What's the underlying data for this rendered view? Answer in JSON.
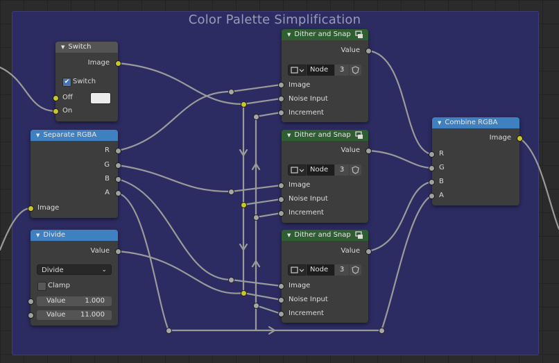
{
  "frame": {
    "title": "Color Palette Simplification"
  },
  "switch_node": {
    "title": "Switch",
    "output_image": "Image",
    "checkbox_label": "Switch",
    "checkbox_checked": true,
    "input_off": "Off",
    "input_on": "On",
    "swatch_color": "#ececec"
  },
  "separate_rgba": {
    "title": "Separate RGBA",
    "outputs": [
      "R",
      "G",
      "B",
      "A"
    ],
    "input_image": "Image"
  },
  "divide": {
    "title": "Divide",
    "output_value": "Value",
    "operation": "Divide",
    "clamp_label": "Clamp",
    "clamp_checked": false,
    "value1_label": "Value",
    "value1": "1.000",
    "value2_label": "Value",
    "value2": "11.000"
  },
  "dither_nodes": [
    {
      "title": "Dither and Snap",
      "output_value": "Value",
      "group_name": "Node",
      "group_users": "3",
      "inputs": [
        "Image",
        "Noise Input",
        "Increment"
      ]
    },
    {
      "title": "Dither and Snap",
      "output_value": "Value",
      "group_name": "Node",
      "group_users": "3",
      "inputs": [
        "Image",
        "Noise Input",
        "Increment"
      ]
    },
    {
      "title": "Dither and Snap",
      "output_value": "Value",
      "group_name": "Node",
      "group_users": "3",
      "inputs": [
        "Image",
        "Noise Input",
        "Increment"
      ]
    }
  ],
  "combine_rgba": {
    "title": "Combine RGBA",
    "output_image": "Image",
    "inputs": [
      "R",
      "G",
      "B",
      "A"
    ]
  },
  "colors": {
    "frame_bg": "#2d2c62",
    "node_bg": "#3d3d3d",
    "header_blue": "#3f80c0",
    "header_green": "#2e5e31",
    "socket_color": "#c7c729",
    "socket_float": "#a1a1a1",
    "wire": "#9a9a9a"
  }
}
